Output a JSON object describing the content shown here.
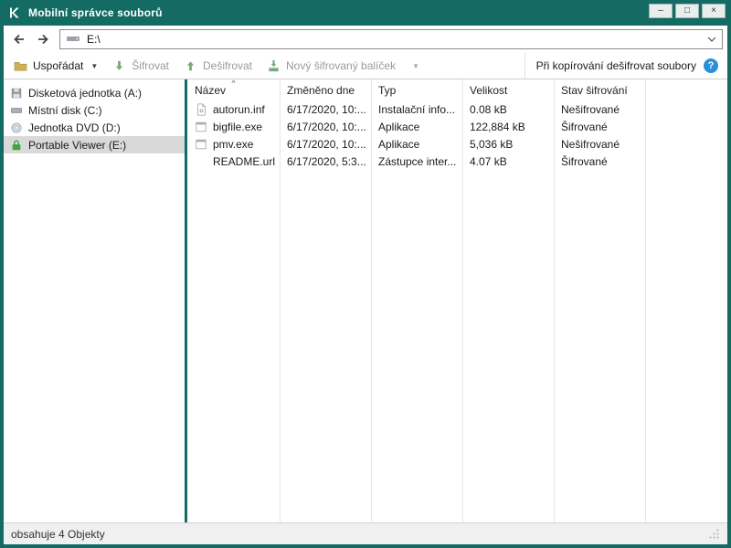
{
  "window": {
    "title": "Mobilní správce souborů"
  },
  "titlebar": {
    "minimize": "–",
    "maximize": "□",
    "close": "×"
  },
  "navbar": {
    "address": "E:\\"
  },
  "toolbar": {
    "organize_label": "Uspořádat",
    "encrypt_label": "Šifrovat",
    "decrypt_label": "Dešifrovat",
    "new_package_label": "Nový šifrovaný balíček",
    "caret": "▼",
    "copy_decrypt_label": "Při kopírování dešifrovat soubory",
    "info_glyph": "?"
  },
  "sidebar": {
    "items": [
      {
        "label": "Disketová jednotka (A:)",
        "icon": "floppy-icon",
        "selected": false
      },
      {
        "label": "Místní disk (C:)",
        "icon": "hdd-icon",
        "selected": false
      },
      {
        "label": "Jednotka DVD (D:)",
        "icon": "dvd-icon",
        "selected": false
      },
      {
        "label": "Portable Viewer (E:)",
        "icon": "lock-icon",
        "selected": true
      }
    ]
  },
  "table": {
    "sort_indicator": "^",
    "columns": [
      "Název",
      "Změněno dne",
      "Typ",
      "Velikost",
      "Stav šifrování"
    ],
    "rows": [
      {
        "name": "autorun.inf",
        "modified": "6/17/2020, 10:...",
        "type": "Instalační info...",
        "size": "0.08 kB",
        "status": "Nešifrované",
        "icon": "setup-info-icon"
      },
      {
        "name": "bigfile.exe",
        "modified": "6/17/2020, 10:...",
        "type": "Aplikace",
        "size": "122,884 kB",
        "status": "Šifrované",
        "icon": "application-icon"
      },
      {
        "name": "pmv.exe",
        "modified": "6/17/2020, 10:...",
        "type": "Aplikace",
        "size": "5,036 kB",
        "status": "Nešifrované",
        "icon": "application-icon"
      },
      {
        "name": "README.url",
        "modified": "6/17/2020, 5:3...",
        "type": "Zástupce inter...",
        "size": "4.07 kB",
        "status": "Šifrované",
        "icon": "none"
      }
    ]
  },
  "statusbar": {
    "text": "obsahuje 4 Objekty"
  },
  "colors": {
    "chrome": "#136b63",
    "selection": "#d9d9d9",
    "accent_green": "#5aa55c",
    "info_blue": "#2a8ed8",
    "disabled_text": "#9a9a9a"
  }
}
